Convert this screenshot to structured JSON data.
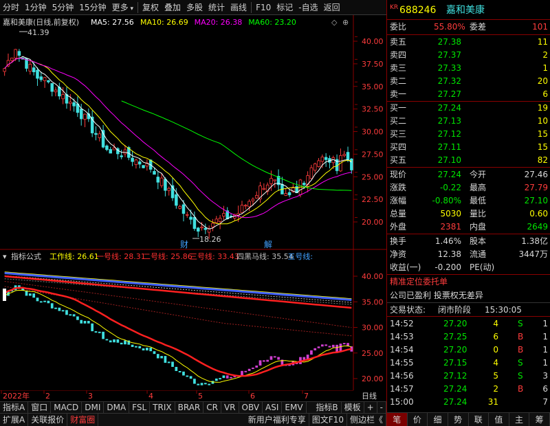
{
  "toolbar": {
    "items": [
      "分时",
      "1分钟",
      "5分钟",
      "15分钟",
      "更多",
      "复权",
      "叠加",
      "多股",
      "统计",
      "画线",
      "F10",
      "标记",
      "-自选",
      "返回"
    ]
  },
  "main_chart": {
    "title": "嘉和美康(日线,前复权)",
    "ma": [
      {
        "label": "MA5: 27.56",
        "color": "#ffffff"
      },
      {
        "label": "MA10: 26.69",
        "color": "#ffff00"
      },
      {
        "label": "MA20: 26.38",
        "color": "#ff00ff"
      },
      {
        "label": "MA60: 23.20",
        "color": "#00ff00"
      }
    ],
    "price_ticks": [
      "40.00",
      "37.50",
      "35.00",
      "32.50",
      "30.00",
      "27.50",
      "25.00",
      "22.50",
      "20.00"
    ],
    "high_label": "41.39",
    "low_label": "18.26",
    "marker_cai": "财",
    "marker_jie": "解"
  },
  "indicator": {
    "title": "指标公式",
    "lines": [
      {
        "label": "工作线: 26.61",
        "color": "#ffff00"
      },
      {
        "label": "一号线: 28.31",
        "color": "#ff3030"
      },
      {
        "label": "二号线: 25.86",
        "color": "#ff3030"
      },
      {
        "label": "三号线: 33.43",
        "color": "#ff3030"
      },
      {
        "label": "四黑马线: 35.54",
        "color": "#c0c0c0"
      },
      {
        "label": "五号线:",
        "color": "#40a0ff"
      }
    ],
    "ticks": [
      "40.00",
      "35.00",
      "30.00",
      "25.00",
      "20.00"
    ]
  },
  "date_axis": {
    "labels": [
      "2022年",
      "2",
      "3",
      "4",
      "5",
      "6",
      "7"
    ],
    "period": "日线"
  },
  "tabs_row1": [
    "指标A",
    "窗口",
    "MACD",
    "DMI",
    "DMA",
    "FSL",
    "TRIX",
    "BRAR",
    "CR",
    "VR",
    "OBV",
    "ASI",
    "EMV",
    "指标B",
    "模板",
    "+",
    "-"
  ],
  "tabs_row2": [
    "扩展A",
    "关联报价",
    "财富圈",
    "新用户福利专享",
    "图文F10",
    "侧边栏《"
  ],
  "panel": {
    "market": "KR",
    "code": "688246",
    "name": "嘉和美康",
    "weibi_label": "委比",
    "weibi_value": "55.80%",
    "weicha_label": "委差",
    "weicha_value": "101",
    "asks": [
      {
        "label": "卖五",
        "price": "27.38",
        "vol": "11"
      },
      {
        "label": "卖四",
        "price": "27.37",
        "vol": "2"
      },
      {
        "label": "卖三",
        "price": "27.33",
        "vol": "1"
      },
      {
        "label": "卖二",
        "price": "27.32",
        "vol": "20"
      },
      {
        "label": "卖一",
        "price": "27.27",
        "vol": "6"
      }
    ],
    "bids": [
      {
        "label": "买一",
        "price": "27.24",
        "vol": "19"
      },
      {
        "label": "买二",
        "price": "27.13",
        "vol": "10"
      },
      {
        "label": "买三",
        "price": "27.12",
        "vol": "15"
      },
      {
        "label": "买四",
        "price": "27.11",
        "vol": "15"
      },
      {
        "label": "买五",
        "price": "27.10",
        "vol": "82"
      }
    ],
    "stats": [
      {
        "l1": "现价",
        "v1": "27.24",
        "c1": "c-g",
        "l2": "今开",
        "v2": "27.46",
        "c2": "c-w"
      },
      {
        "l1": "涨跌",
        "v1": "-0.22",
        "c1": "c-g",
        "l2": "最高",
        "v2": "27.79",
        "c2": "c-r"
      },
      {
        "l1": "涨幅",
        "v1": "-0.80%",
        "c1": "c-g",
        "l2": "最低",
        "v2": "27.10",
        "c2": "c-g"
      },
      {
        "l1": "总量",
        "v1": "5030",
        "c1": "c-y",
        "l2": "量比",
        "v2": "0.60",
        "c2": "c-y"
      },
      {
        "l1": "外盘",
        "v1": "2381",
        "c1": "c-r",
        "l2": "内盘",
        "v2": "2649",
        "c2": "c-g"
      }
    ],
    "stats2": [
      {
        "l1": "换手",
        "v1": "1.46%",
        "l2": "股本",
        "v2": "1.38亿"
      },
      {
        "l1": "净资",
        "v1": "12.38",
        "l2": "流通",
        "v2": "3447万"
      },
      {
        "l1": "收益(一)",
        "v1": "-0.200",
        "l2": "PE(动)",
        "v2": ""
      }
    ],
    "promo": "精准定位委托单",
    "notice": "公司已盈利 投票权无差异",
    "status_label": "交易状态:",
    "status_value": "闭市阶段",
    "status_time": "15:30:05",
    "ticks": [
      {
        "time": "14:52",
        "price": "27.20",
        "vol": "4",
        "side": "S",
        "n": "1"
      },
      {
        "time": "14:53",
        "price": "27.25",
        "vol": "6",
        "side": "B",
        "n": "1"
      },
      {
        "time": "14:54",
        "price": "27.20",
        "vol": "0",
        "side": "B",
        "n": "1"
      },
      {
        "time": "14:55",
        "price": "27.15",
        "vol": "4",
        "side": "S",
        "n": "1"
      },
      {
        "time": "14:56",
        "price": "27.12",
        "vol": "5",
        "side": "S",
        "n": "3"
      },
      {
        "time": "14:57",
        "price": "27.24",
        "vol": "2",
        "side": "B",
        "n": "6"
      },
      {
        "time": "15:00",
        "price": "27.24",
        "vol": "31",
        "side": "",
        "n": "7"
      }
    ],
    "bottom_tabs": [
      "笔",
      "价",
      "细",
      "势",
      "联",
      "值",
      "主",
      "筹"
    ]
  }
}
